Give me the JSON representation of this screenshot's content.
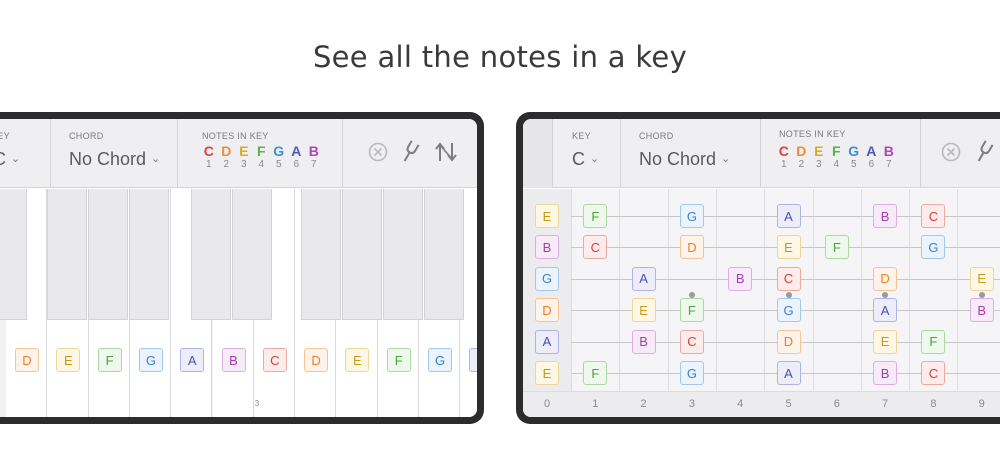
{
  "headline": "See all the notes in a key",
  "toolbar": {
    "key_caption": "KEY",
    "key_value": "C",
    "chord_caption": "CHORD",
    "chord_value": "No Chord",
    "notes_caption": "NOTES IN KEY",
    "notes": [
      {
        "letter": "C",
        "degree": "1",
        "color": "#e0423b"
      },
      {
        "letter": "D",
        "degree": "2",
        "color": "#ef8b3a"
      },
      {
        "letter": "E",
        "degree": "3",
        "color": "#d8ac27"
      },
      {
        "letter": "F",
        "degree": "4",
        "color": "#57b347"
      },
      {
        "letter": "G",
        "degree": "5",
        "color": "#3f8ed8"
      },
      {
        "letter": "A",
        "degree": "6",
        "color": "#4f58c6"
      },
      {
        "letter": "B",
        "degree": "7",
        "color": "#b046b8"
      }
    ],
    "icons": [
      "clear-icon",
      "tuning-fork-icon",
      "flip-icon"
    ]
  },
  "note_styles": {
    "C": {
      "text": "#d3403a",
      "bg": "#fdeceb",
      "border": "#ecaaa5"
    },
    "D": {
      "text": "#ea7f2e",
      "bg": "#fef3e8",
      "border": "#f3c59b"
    },
    "E": {
      "text": "#c79a1e",
      "bg": "#fdf7e4",
      "border": "#eed69a"
    },
    "F": {
      "text": "#48a63b",
      "bg": "#eef8ec",
      "border": "#abd9a2"
    },
    "G": {
      "text": "#3984cb",
      "bg": "#ebf3fc",
      "border": "#a4c8ec"
    },
    "A": {
      "text": "#4650b8",
      "bg": "#ecedf9",
      "border": "#aeb3e6"
    },
    "B": {
      "text": "#a43eab",
      "bg": "#f8ebf9",
      "border": "#ddaee1"
    }
  },
  "keyboard": {
    "notes": [
      "D",
      "E",
      "F",
      "G",
      "A",
      "B",
      "C",
      "D",
      "E",
      "F",
      "G",
      "A"
    ],
    "octave_label": "3"
  },
  "fretboard": {
    "fret_numbers": [
      "0",
      "1",
      "2",
      "3",
      "4",
      "5",
      "6",
      "7",
      "8",
      "9"
    ],
    "strings": [
      [
        [
          0,
          "E"
        ],
        [
          1,
          "F"
        ],
        [
          3,
          "G"
        ],
        [
          5,
          "A"
        ],
        [
          7,
          "B"
        ],
        [
          8,
          "C"
        ]
      ],
      [
        [
          0,
          "B"
        ],
        [
          1,
          "C"
        ],
        [
          3,
          "D"
        ],
        [
          5,
          "E"
        ],
        [
          6,
          "F"
        ],
        [
          8,
          "G"
        ]
      ],
      [
        [
          0,
          "G"
        ],
        [
          2,
          "A"
        ],
        [
          4,
          "B"
        ],
        [
          5,
          "C"
        ],
        [
          7,
          "D"
        ],
        [
          9,
          "E"
        ]
      ],
      [
        [
          0,
          "D"
        ],
        [
          2,
          "E"
        ],
        [
          3,
          "F"
        ],
        [
          5,
          "G"
        ],
        [
          7,
          "A"
        ],
        [
          9,
          "B"
        ]
      ],
      [
        [
          0,
          "A"
        ],
        [
          2,
          "B"
        ],
        [
          3,
          "C"
        ],
        [
          5,
          "D"
        ],
        [
          7,
          "E"
        ],
        [
          8,
          "F"
        ]
      ],
      [
        [
          0,
          "E"
        ],
        [
          1,
          "F"
        ],
        [
          3,
          "G"
        ],
        [
          5,
          "A"
        ],
        [
          7,
          "B"
        ],
        [
          8,
          "C"
        ]
      ]
    ],
    "inlay_frets": [
      3,
      5,
      7,
      9
    ]
  }
}
